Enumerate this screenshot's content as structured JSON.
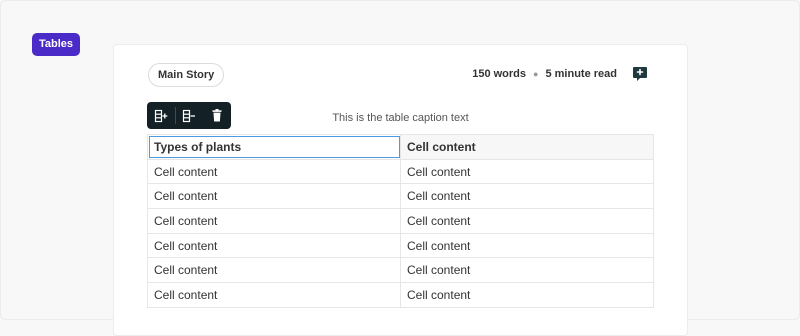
{
  "section_tag": "Tables",
  "editor": {
    "story_name": "Main Story",
    "word_count": "150 words",
    "read_time": "5 minute read",
    "comment_icon": "add-comment-icon"
  },
  "table_toolbar": {
    "buttons": [
      {
        "icon": "insert-column-icon"
      },
      {
        "icon": "delete-column-icon"
      },
      {
        "icon": "trash-icon"
      }
    ]
  },
  "table": {
    "caption": "This is the table caption text",
    "headers": [
      "Types of plants",
      "Cell content"
    ],
    "rows": [
      [
        "Cell content",
        "Cell content"
      ],
      [
        "Cell content",
        "Cell content"
      ],
      [
        "Cell content",
        "Cell content"
      ],
      [
        "Cell content",
        "Cell content"
      ],
      [
        "Cell content",
        "Cell content"
      ],
      [
        "Cell content",
        "Cell content"
      ]
    ]
  },
  "colors": {
    "tag_bg": "#4a2bc7",
    "toolbar_bg": "#132025",
    "selection": "#4c9be0",
    "comment_icon": "#1f3a3f"
  }
}
